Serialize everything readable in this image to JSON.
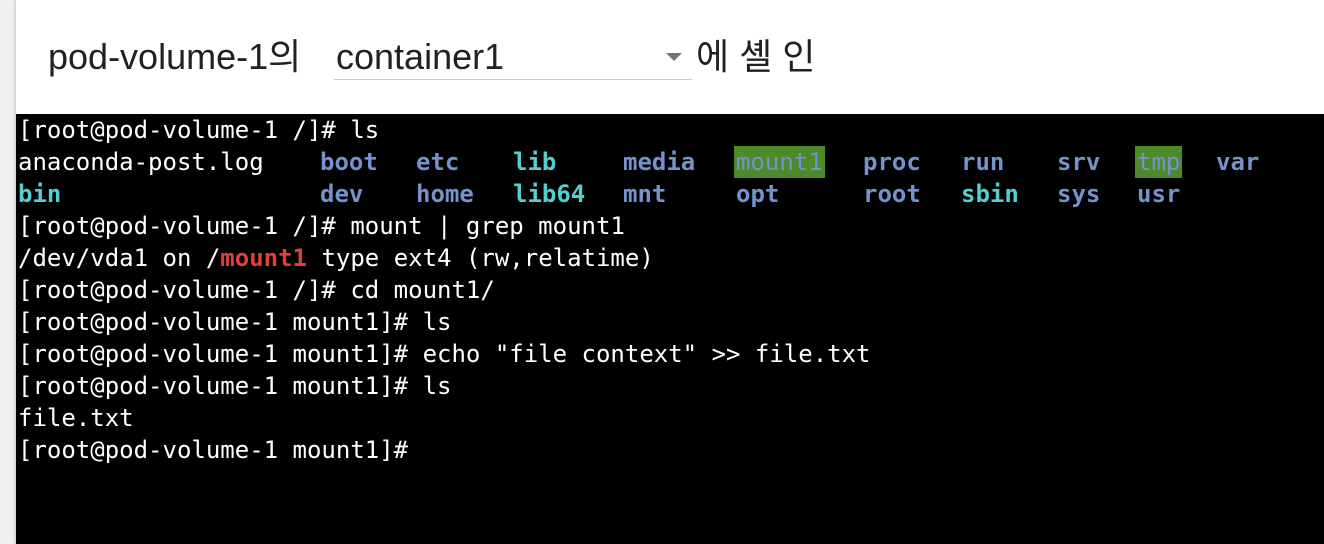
{
  "header": {
    "prefix": "pod-volume-1의",
    "container_select": {
      "value": "container1"
    },
    "suffix": "에 셸 인"
  },
  "terminal": {
    "cmd1": "[root@pod-volume-1 /]# ls",
    "ls_plain": "anaconda-post.log",
    "ls_bin": "bin",
    "ls_boot": "boot",
    "ls_dev": "dev",
    "ls_etc": "etc",
    "ls_home": "home",
    "ls_lib": "lib",
    "ls_lib64": "lib64",
    "ls_media": "media",
    "ls_mnt": "mnt",
    "ls_mount1": "mount1",
    "ls_opt": "opt",
    "ls_proc": "proc",
    "ls_root": "root",
    "ls_run": "run",
    "ls_sbin": "sbin",
    "ls_srv": "srv",
    "ls_sys": "sys",
    "ls_tmp": "tmp",
    "ls_usr": "usr",
    "ls_var": "var",
    "cmd2": "[root@pod-volume-1 /]# mount | grep mount1",
    "out2_pre": "/dev/vda1 on /",
    "out2_match": "mount1",
    "out2_post": " type ext4 (rw,relatime)",
    "cmd3": "[root@pod-volume-1 /]# cd mount1/",
    "cmd4": "[root@pod-volume-1 mount1]# ls",
    "cmd5": "[root@pod-volume-1 mount1]# echo \"file context\" >> file.txt",
    "cmd6": "[root@pod-volume-1 mount1]# ls",
    "out6": "file.txt",
    "prompt": "[root@pod-volume-1 mount1]#"
  },
  "colors": {
    "terminal_bg": "#000000",
    "terminal_fg": "#ffffff",
    "dir": "#7393cd",
    "symlink": "#52d0d0",
    "sticky_bg": "#4c8a2a",
    "grep_match": "#e0403a"
  }
}
